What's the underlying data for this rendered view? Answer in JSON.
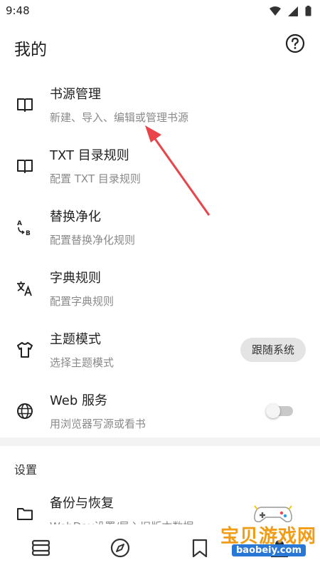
{
  "status_bar": {
    "time": "9:48",
    "icons": [
      "wifi-icon",
      "cellular-icon",
      "battery-icon"
    ]
  },
  "app_bar": {
    "title": "我的",
    "help_icon": "help-circle-icon"
  },
  "menu": [
    {
      "title": "书源管理",
      "subtitle": "新建、导入、编辑或管理书源",
      "icon": "book-open-icon"
    },
    {
      "title": "TXT 目录规则",
      "subtitle": "配置 TXT 目录规则",
      "icon": "book-open-icon"
    },
    {
      "title": "替换净化",
      "subtitle": "配置替换净化规则",
      "icon": "replace-ab-icon"
    },
    {
      "title": "字典规则",
      "subtitle": "配置字典规则",
      "icon": "translate-icon"
    },
    {
      "title": "主题模式",
      "subtitle": "选择主题模式",
      "icon": "tshirt-icon",
      "chip": "跟随系统"
    },
    {
      "title": "Web 服务",
      "subtitle": "用浏览器写源或看书",
      "icon": "globe-icon",
      "switch_on": false
    }
  ],
  "settings_section": {
    "header": "设置",
    "first_item": {
      "title": "备份与恢复",
      "subtitle": "WebDav设置/导入旧版本数据",
      "icon": "folder-icon"
    }
  },
  "bottom_nav": [
    "bookshelf-icon",
    "discover-compass-icon",
    "rss-bookmark-icon",
    "person-icon"
  ],
  "watermark": {
    "title": "宝贝游戏网",
    "url": "baobeiy.com"
  },
  "colors": {
    "arrow": "#e8444a",
    "chip_bg": "#e4e4e4",
    "subtitle": "#8a8a8a",
    "divider": "#f3f3f3",
    "watermark_orange": "#f29b14",
    "watermark_blue": "#2a78d6"
  }
}
